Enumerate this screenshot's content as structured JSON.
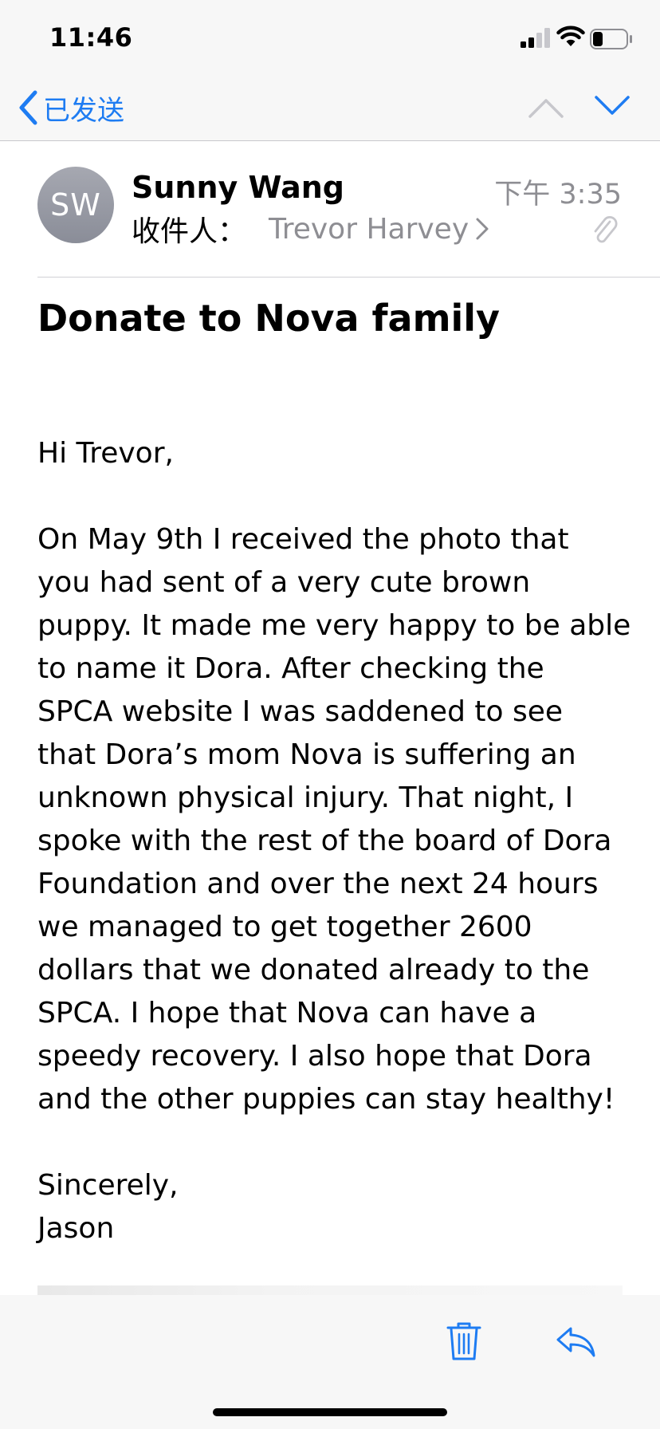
{
  "status_bar": {
    "time": "11:46",
    "signal_bars": 2,
    "battery_level": 0.3
  },
  "navigation": {
    "back_label": "已发送",
    "icons": [
      "chevron-left-icon",
      "chevron-up-icon",
      "chevron-down-icon"
    ]
  },
  "message": {
    "avatar_initials": "SW",
    "sender": "Sunny Wang",
    "date": "下午 3:35",
    "to_label": "收件人：",
    "recipient": "Trevor Harvey",
    "has_attachment": true,
    "subject": "Donate to Nova family",
    "greeting": "Hi Trevor,",
    "body": "On May 9th I received the photo that\nyou had sent of a very cute brown\npuppy. It made me very happy to be able\nto name it Dora. After checking the\nSPCA website I was saddened to see\nthat Dora’s mom Nova is suffering an\nunknown physical injury. That night, I\nspoke with the rest of the board of Dora\nFoundation and over the next 24 hours\nwe managed to get together 2600\ndollars that we donated already to the\nSPCA. I hope that Nova can have a\nspeedy recovery. I also hope that Dora\nand the other puppies can stay healthy!",
    "closing": "Sincerely,",
    "signature": "Jason"
  },
  "toolbar": {
    "icons": [
      "trash-icon",
      "reply-icon"
    ]
  },
  "colors": {
    "accent": "#1e7cf2",
    "secondary_text": "#8e8e93",
    "bar_background": "#f7f7f7"
  }
}
